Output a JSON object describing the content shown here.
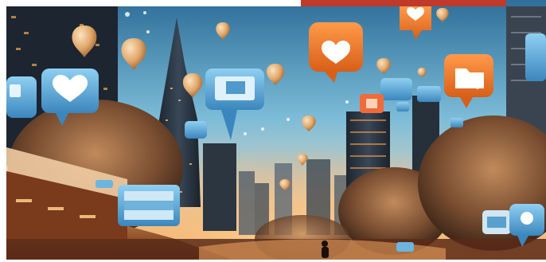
{
  "image": {
    "kind": "illustration",
    "subject": "social-media-city",
    "palette": {
      "sky_top": "#3d7fa8",
      "sky_mid": "#8ec9e2",
      "sky_low": "#f1d6b0",
      "glow": "#ff9a3c",
      "bubble_blue": "#5aa9d8",
      "bubble_orange": "#f07a2a",
      "heart": "#ffffff",
      "balloon": "#e6b47c",
      "tower": "#2a3440",
      "foliage": "#8a5a3a",
      "top_bar": "#c0392b"
    },
    "icons": [
      "heart-icon",
      "image-icon",
      "folder-icon",
      "message-icon",
      "balloon-icon"
    ]
  }
}
